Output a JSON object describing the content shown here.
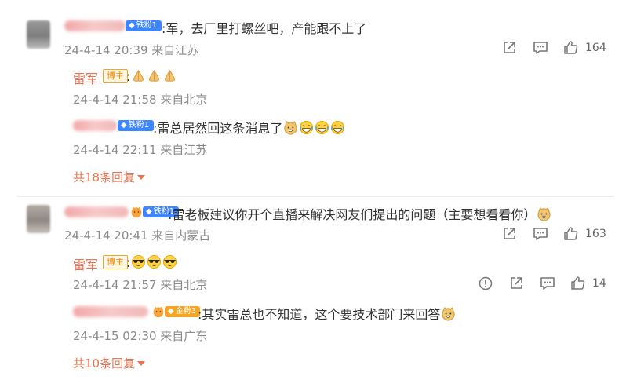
{
  "comments": [
    {
      "badge_text": "铁粉1",
      "text": ":军，去厂里打螺丝吧，产能跟不上了",
      "meta": "24-4-14 20:39 来自江苏",
      "likes": "164",
      "replies": [
        {
          "name": "雷军",
          "badge_text": "博主",
          "text": ":",
          "meta": "24-4-14 21:58 来自北京",
          "emojis": [
            "folded-hands-emoji",
            "folded-hands-emoji",
            "folded-hands-emoji"
          ]
        },
        {
          "badge_text": "铁粉1",
          "text": ":雷总居然回这条消息了",
          "meta": "24-4-14 22:11 来自江苏",
          "emojis": [
            "doge-emoji",
            "laughing-emoji",
            "laughing-emoji",
            "laughing-emoji"
          ]
        }
      ],
      "more_replies": "共18条回复"
    },
    {
      "badge_text": "铁粉1",
      "text": ":雷老板建议你开个直播来解决网友们提出的问题（主要想看看你）",
      "meta": "24-4-14 20:41 来自内蒙古",
      "likes": "163",
      "replies": [
        {
          "name": "雷军",
          "badge_text": "博主",
          "text": ":",
          "meta": "24-4-14 21:57 来自北京",
          "likes": "14",
          "emojis": [
            "sunglasses-emoji",
            "sunglasses-emoji",
            "sunglasses-emoji"
          ]
        },
        {
          "badge_text": "金粉3",
          "text": ":其实雷总也不知道，这个要技术部门来回答",
          "meta": "24-4-15 02:30 来自广东",
          "emojis": [
            "doge-emoji"
          ]
        }
      ],
      "more_replies": "共10条回复"
    }
  ],
  "colors": {
    "accent": "#eb7350",
    "meta": "#8a8a8a",
    "fan_badge": "#3d86ff",
    "gold_badge": "#f6a623"
  }
}
